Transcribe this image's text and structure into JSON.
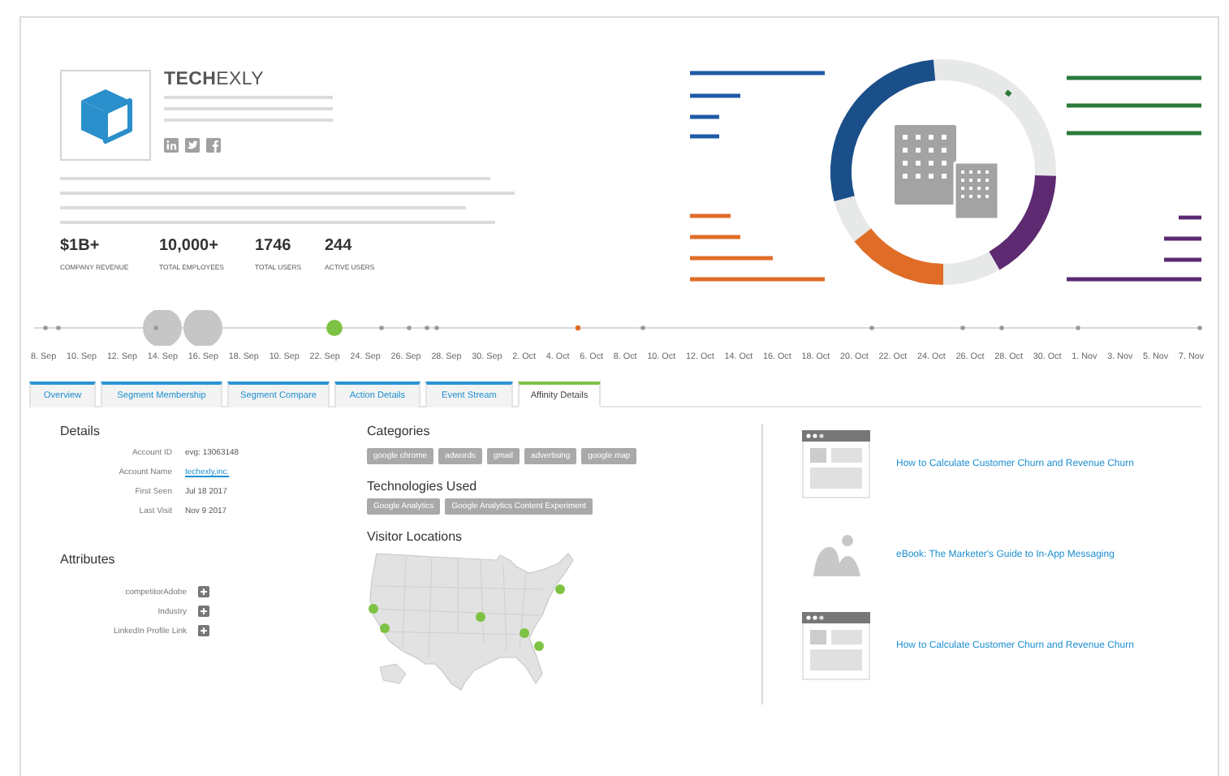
{
  "brand": {
    "name": "**TECH**EXLY"
  },
  "stats": [
    {
      "value": "$1B+",
      "label": "COMPANY REVENUE"
    },
    {
      "value": "10,000+",
      "label": "TOTAL EMPLOYEES"
    },
    {
      "value": "1746",
      "label": "TOTAL USERS"
    },
    {
      "value": "244",
      "label": "ACTIVE USERS"
    }
  ],
  "timeline": {
    "labels": [
      "8. Sep",
      "10. Sep",
      "12. Sep",
      "14. Sep",
      "16. Sep",
      "18. Sep",
      "10. Sep",
      "22. Sep",
      "24. Sep",
      "26. Sep",
      "28. Sep",
      "30. Sep",
      "2. Oct",
      "4. Oct",
      "6. Oct",
      "8. Oct",
      "10. Oct",
      "12. Oct",
      "14. Oct",
      "16. Oct",
      "18. Oct",
      "20. Oct",
      "22. Oct",
      "24. Oct",
      "26. Oct",
      "28. Oct",
      "30. Oct",
      "1. Nov",
      "3. Nov",
      "5. Nov",
      "7. Nov"
    ]
  },
  "tabs": [
    {
      "label": "Overview",
      "selected": false
    },
    {
      "label": "Segment Membership",
      "selected": false
    },
    {
      "label": "Segment Compare",
      "selected": false
    },
    {
      "label": "Action Details",
      "selected": false
    },
    {
      "label": "Event Stream",
      "selected": false
    },
    {
      "label": "Affinity Details",
      "selected": true
    }
  ],
  "details": {
    "title": "Details",
    "rows": [
      {
        "label": "Account ID",
        "value": "evg: 13063148",
        "kind": "text"
      },
      {
        "label": "Account Name",
        "value": "techexly,inc.",
        "kind": "link"
      },
      {
        "label": "First Seen",
        "value": "Jul 18 2017",
        "kind": "text"
      },
      {
        "label": "Last Visit",
        "value": "Nov 9 2017",
        "kind": "text"
      }
    ]
  },
  "attributes": {
    "title": "Attributes",
    "rows": [
      {
        "label": "competitorAdobe"
      },
      {
        "label": "Industry"
      },
      {
        "label": "LinkedIn Profile Link"
      }
    ]
  },
  "categories": {
    "title": "Categories",
    "tags": [
      "google chrome",
      "adwords",
      "gmail",
      "advertising",
      "google map"
    ]
  },
  "technologies": {
    "title": "Technologies Used",
    "tags": [
      "Google Analytics",
      "Google Analytics Content Experiment"
    ]
  },
  "visitor_locations": {
    "title": "Visitor Locations"
  },
  "resources": [
    {
      "kind": "article",
      "title": "How to Calculate Customer Churn and Revenue Churn"
    },
    {
      "kind": "ebook",
      "title": "eBook: The Marketer's Guide to In-App Messaging"
    },
    {
      "kind": "article",
      "title": "How to Calculate Customer Churn and Revenue Churn"
    }
  ]
}
